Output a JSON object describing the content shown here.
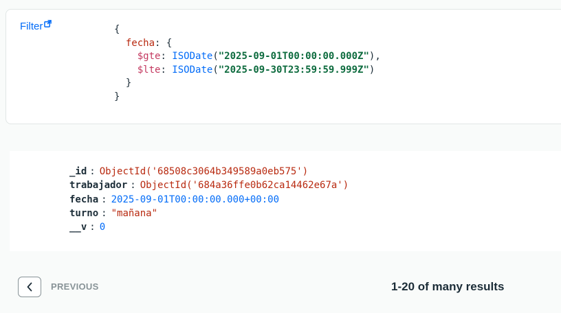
{
  "filter": {
    "label": "Filter",
    "link_icon": "external-link-icon",
    "code": {
      "open_brace": "{",
      "field": "fecha",
      "gte_op": "$gte",
      "lte_op": "$lte",
      "fn": "ISODate",
      "gte_value": "\"2025-09-01T00:00:00.000Z\"",
      "lte_value": "\"2025-09-30T23:59:59.999Z\"",
      "close_brace": "}"
    }
  },
  "document": {
    "fields": [
      {
        "key": "_id",
        "value": "ObjectId('68508c3064b349589a0eb575')"
      },
      {
        "key": "trabajador",
        "value": "ObjectId('684a36ffe0b62ca14462e67a')"
      },
      {
        "key": "fecha",
        "value": "2025-09-01T00:00:00.000+00:00"
      },
      {
        "key": "turno",
        "value": "\"mañana\""
      },
      {
        "key": "__v",
        "value": "0"
      }
    ]
  },
  "pagination": {
    "prev_icon": "chevron-left-icon",
    "previous_label": "PREVIOUS",
    "results_label": "1-20 of many results"
  },
  "colors": {
    "link": "#016bf8",
    "key": "#b8290f",
    "string": "#0d6b3e",
    "text": "#1c2d38",
    "muted": "#889397"
  }
}
